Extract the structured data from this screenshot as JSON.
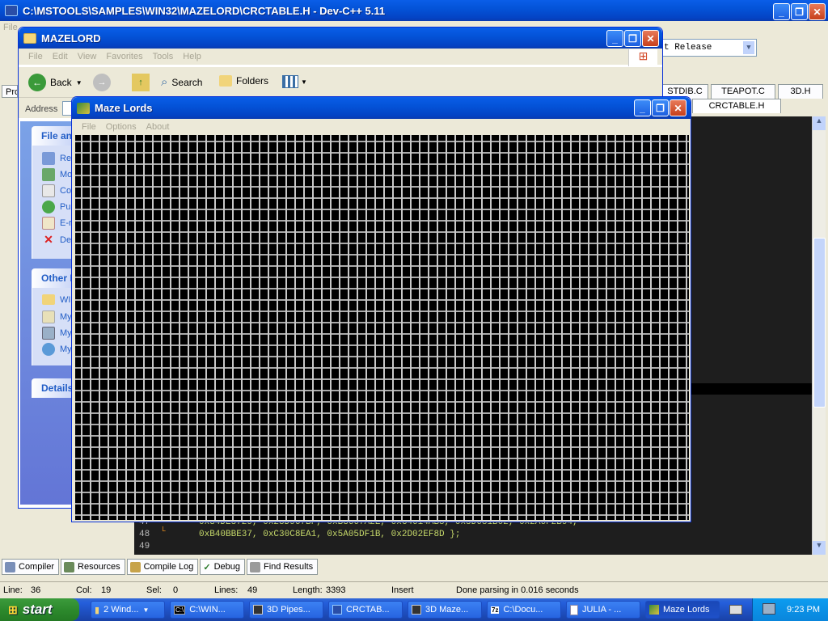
{
  "devcpp": {
    "title": "C:\\MSTOOLS\\SAMPLES\\WIN32\\MAZELORD\\CRCTABLE.H - Dev-C++ 5.11",
    "menu_first": "File",
    "toolbar_combo": "t Release",
    "left_tab": "Pro",
    "file_tabs": [
      "STDIB.C",
      "TEAPOT.C",
      "3D.H",
      "CRCTABLE.H"
    ],
    "code_lines": [
      {
        "num": "47",
        "text": "0x34DE5729, 0x23D967BF, 0xB3667A2E, 0xC4614AB8, 0x5D681B02, 0x2A6F2B94,"
      },
      {
        "num": "48",
        "text": "0xB40BBE37, 0xC30C8EA1, 0x5A05DF1B, 0x2D02EF8D };"
      },
      {
        "num": "49",
        "text": ""
      }
    ],
    "bottom_tabs": [
      "Compiler",
      "Resources",
      "Compile Log",
      "Debug",
      "Find Results"
    ],
    "status": {
      "line_label": "Line:",
      "line": "36",
      "col_label": "Col:",
      "col": "19",
      "sel_label": "Sel:",
      "sel": "0",
      "lines_label": "Lines:",
      "lines": "49",
      "length_label": "Length:",
      "length": "3393",
      "mode": "Insert",
      "message": "Done parsing in 0.016 seconds"
    }
  },
  "explorer": {
    "title": "MAZELORD",
    "menu": [
      "File",
      "Edit",
      "View",
      "Favorites",
      "Tools",
      "Help"
    ],
    "back_label": "Back",
    "search_label": "Search",
    "folders_label": "Folders",
    "address_label": "Address",
    "panel1_title": "File an",
    "panel1_items": [
      "Re",
      "Mo",
      "Co",
      "Pul",
      "E-r",
      "De"
    ],
    "panel2_title": "Other I",
    "panel2_items": [
      "WI",
      "My",
      "My",
      "My"
    ],
    "panel3_title": "Details"
  },
  "maze": {
    "title": "Maze Lords",
    "menu": [
      "File",
      "Options",
      "About"
    ]
  },
  "taskbar": {
    "start_label": "start",
    "buttons": [
      "2 Wind...",
      "C:\\WIN...",
      "3D Pipes...",
      "CRCTAB...",
      "3D Maze...",
      "C:\\Docu...",
      "JULIA - ...",
      "Maze Lords"
    ],
    "clock": "9:23 PM"
  }
}
